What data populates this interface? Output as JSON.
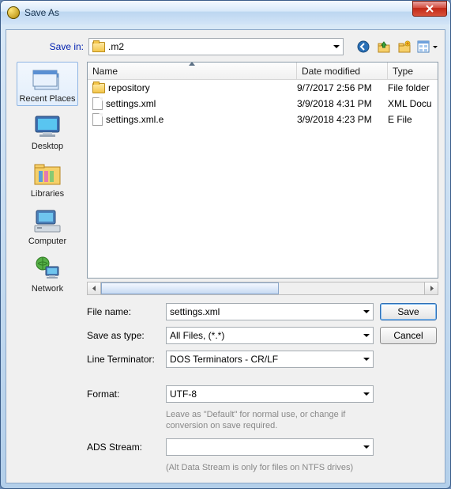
{
  "window": {
    "title": "Save As"
  },
  "savein": {
    "label": "Save in:",
    "folder_icon": "folder-icon",
    "value": ".m2"
  },
  "toolbar_icons": {
    "back": "back-icon",
    "up": "up-one-level-icon",
    "new_folder": "new-folder-icon",
    "view": "view-menu-icon"
  },
  "places": [
    {
      "key": "recent",
      "label": "Recent Places"
    },
    {
      "key": "desktop",
      "label": "Desktop"
    },
    {
      "key": "libraries",
      "label": "Libraries"
    },
    {
      "key": "computer",
      "label": "Computer"
    },
    {
      "key": "network",
      "label": "Network"
    }
  ],
  "listview": {
    "columns": {
      "name": "Name",
      "date": "Date modified",
      "type": "Type"
    },
    "rows": [
      {
        "kind": "folder",
        "name": "repository",
        "date": "9/7/2017 2:56 PM",
        "type": "File folder"
      },
      {
        "kind": "file",
        "name": "settings.xml",
        "date": "3/9/2018 4:31 PM",
        "type": "XML Docu"
      },
      {
        "kind": "file",
        "name": "settings.xml.e",
        "date": "3/9/2018 4:23 PM",
        "type": "E File"
      }
    ]
  },
  "form": {
    "filename_label": "File name:",
    "filename_value": "settings.xml",
    "saveastype_label": "Save as type:",
    "saveastype_value": "All Files, (*.*)",
    "lineterm_label": "Line Terminator:",
    "lineterm_value": "DOS Terminators - CR/LF",
    "format_label": "Format:",
    "format_value": "UTF-8",
    "format_note": "Leave as \"Default\" for normal use, or change if conversion on save required.",
    "ads_label": "ADS Stream:",
    "ads_value": "",
    "ads_note": "(Alt Data Stream is only for files on NTFS drives)"
  },
  "buttons": {
    "save": "Save",
    "cancel": "Cancel"
  }
}
